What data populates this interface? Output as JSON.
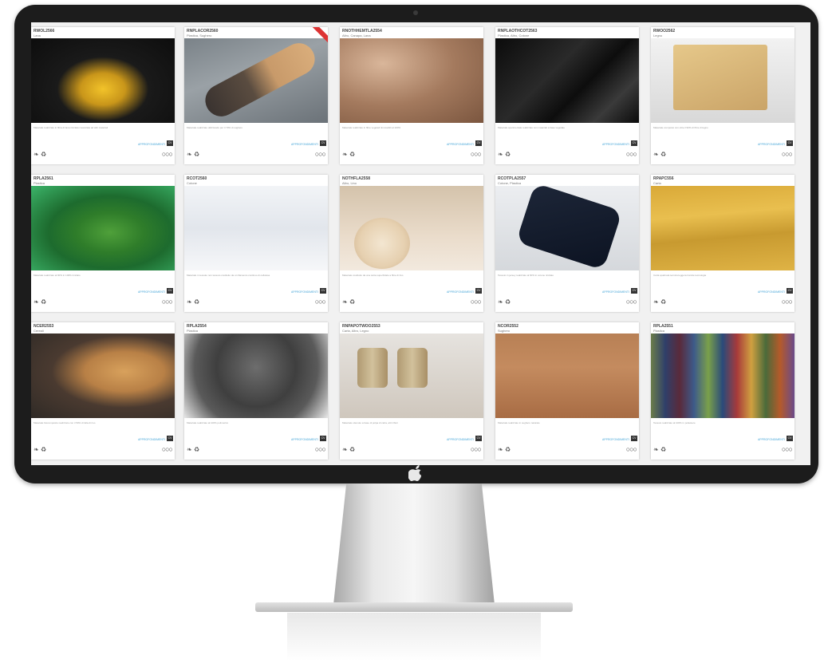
{
  "cards": [
    {
      "code": "RWOL2566",
      "category": "Lana",
      "desc": "Materiale realizzato in fibra di lana riciclata mescolata ad altri materiali",
      "more": "APPROFONDIMENTI",
      "tag": "CV",
      "has_ribbon": false
    },
    {
      "code": "RNPLACOR2560",
      "category": "Plastica, Sughero",
      "desc": "Materiale realizzato utilizzando per il 70% di sughero",
      "more": "APPROFONDIMENTI",
      "tag": "CV",
      "has_ribbon": true
    },
    {
      "code": "RNOTHHEMTLA2554",
      "category": "Altro, Canapa, Lana",
      "desc": "Materiale realizzato in fibre vegetali rinnovabili al 100%",
      "more": "APPROFONDIMENTI",
      "tag": "CV",
      "has_ribbon": false
    },
    {
      "code": "RNPLAOTHCOT2563",
      "category": "Plastica, Altro, Cotone",
      "desc": "Materiale sperimentale realizzato con materiali a base vegetale",
      "more": "APPROFONDIMENTI",
      "tag": "CV",
      "has_ribbon": false
    },
    {
      "code": "RWOO2562",
      "category": "Legno",
      "desc": "Materiale composto con oltre il 90% di fibre di legno",
      "more": "APPROFONDIMENTI",
      "tag": "CV",
      "has_ribbon": false
    },
    {
      "code": "RPLA2561",
      "category": "Plastica",
      "desc": "Materiale realizzato al 90% in 100% riciclato",
      "more": "APPROFONDIMENTI",
      "tag": "CV",
      "has_ribbon": false
    },
    {
      "code": "RCOT2560",
      "category": "Cotone",
      "desc": "Materiale in tessuto non tessuto costituito da un filamento continuo di cellulosa",
      "more": "APPROFONDIMENTI",
      "tag": "CV",
      "has_ribbon": false
    },
    {
      "code": "NOTHFLA2558",
      "category": "Altro, Lino",
      "desc": "Materiale costituito da una carta superficiale a fibre di lino",
      "more": "APPROFONDIMENTI",
      "tag": "CV",
      "has_ribbon": false
    },
    {
      "code": "RCOTPLA2557",
      "category": "Cotone, Plastica",
      "desc": "Tessuto in jersey realizzato al 60% in cotone riciclato",
      "more": "APPROFONDIMENTI",
      "tag": "CV",
      "has_ribbon": false
    },
    {
      "code": "RPAPC556",
      "category": "Carta",
      "desc": "Carta spalmata tecnica leggera tramite tecnologia",
      "more": "APPROFONDIMENTI",
      "tag": "CV",
      "has_ribbon": false
    },
    {
      "code": "NCER2553",
      "category": "Cereali",
      "desc": "Materiale biocomposito realizzato con il 50% di lolla di riso",
      "more": "APPROFONDIMENTI",
      "tag": "CV",
      "has_ribbon": false
    },
    {
      "code": "RPLA2554",
      "category": "Plastica",
      "desc": "Materiale realizzato al 100% polimerico",
      "more": "APPROFONDIMENTI",
      "tag": "CV",
      "has_ribbon": false
    },
    {
      "code": "RNPAPOTWOO2553",
      "category": "Carta, Altro, Legno",
      "desc": "Materiale ottenuto a base di polpa di carta, altri rifiuti",
      "more": "APPROFONDIMENTI",
      "tag": "CV",
      "has_ribbon": false
    },
    {
      "code": "NCOR2552",
      "category": "Sughero",
      "desc": "Materiale realizzato in sughero naturale",
      "more": "APPROFONDIMENTI",
      "tag": "CV",
      "has_ribbon": false
    },
    {
      "code": "RPLA2551",
      "category": "Plastica",
      "desc": "Tessuto realizzato al 100% in poliestere",
      "more": "APPROFONDIMENTI",
      "tag": "CV",
      "has_ribbon": false
    }
  ],
  "icons": {
    "leaf": "leaf-icon",
    "recycle": "recycle-icon",
    "rings": "circle-icons"
  },
  "colors": {
    "accent": "#47a6d8",
    "ribbon": "#d33333"
  }
}
